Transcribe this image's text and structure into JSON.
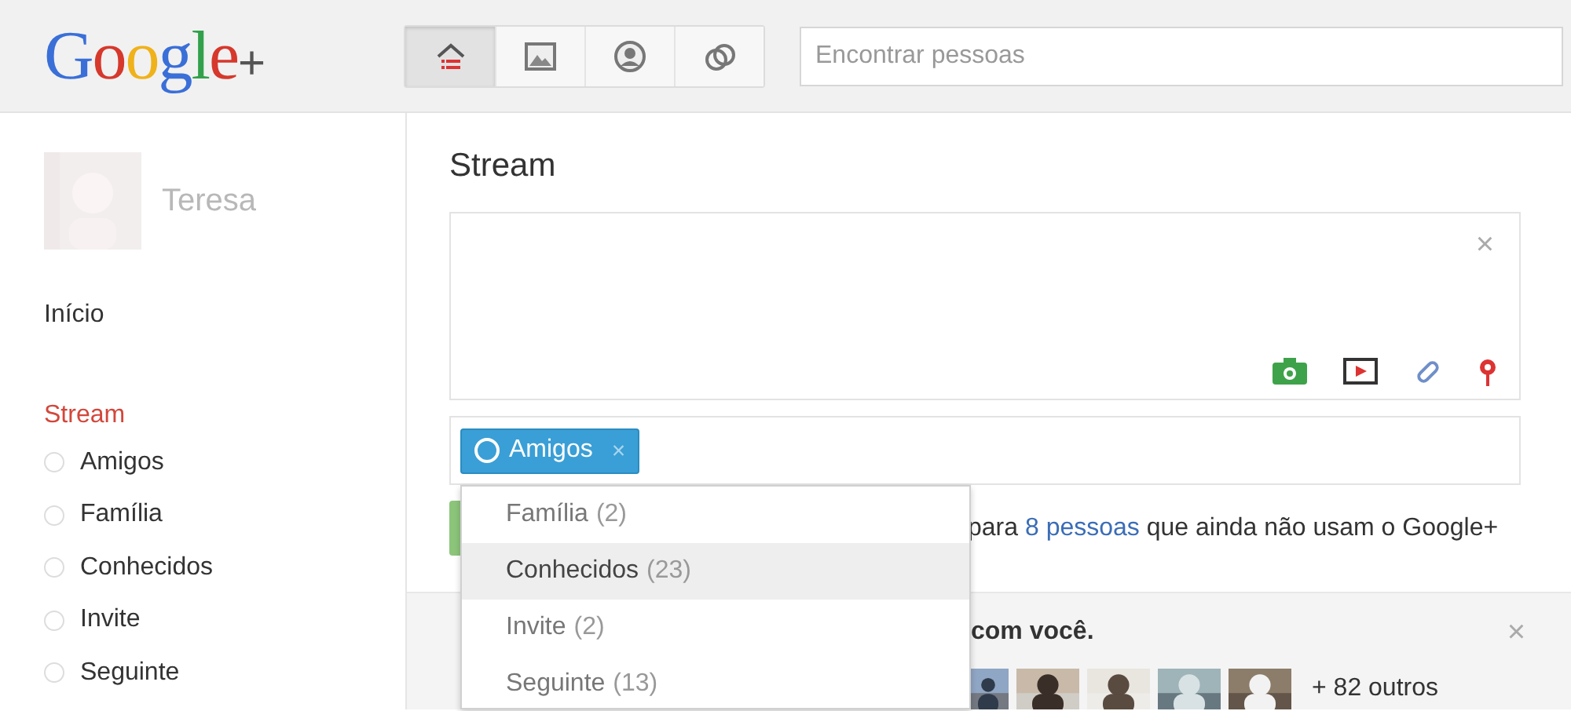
{
  "header": {
    "logo": "Google+",
    "nav_tabs": [
      {
        "kind": "home",
        "selected": true
      },
      {
        "kind": "photos",
        "selected": false
      },
      {
        "kind": "profile",
        "selected": false
      },
      {
        "kind": "circles",
        "selected": false
      }
    ],
    "search": {
      "placeholder": "Encontrar pessoas"
    }
  },
  "sidebar": {
    "profile": {
      "name": "Teresa"
    },
    "home": "Início",
    "stream": {
      "label": "Stream",
      "circles": [
        "Amigos",
        "Família",
        "Conhecidos",
        "Invite",
        "Seguinte"
      ]
    }
  },
  "main": {
    "title": "Stream",
    "composer": {
      "close": "×"
    },
    "share": {
      "chips": [
        {
          "label": "Amigos",
          "remove": "×"
        }
      ]
    },
    "dropdown": [
      {
        "label": "Família",
        "count": "(2)",
        "selected": false
      },
      {
        "label": "Conhecidos",
        "count": "(23)",
        "selected": true
      },
      {
        "label": "Invite",
        "count": "(2)",
        "selected": false
      },
      {
        "label": "Seguinte",
        "count": "(13)",
        "selected": false
      }
    ],
    "notice": {
      "before": "para",
      "link": "8 pessoas",
      "after": "que ainda não usam o Google+"
    },
    "suggestion": {
      "text": "com você.",
      "close": "×",
      "more": "+ 82 outros"
    }
  }
}
